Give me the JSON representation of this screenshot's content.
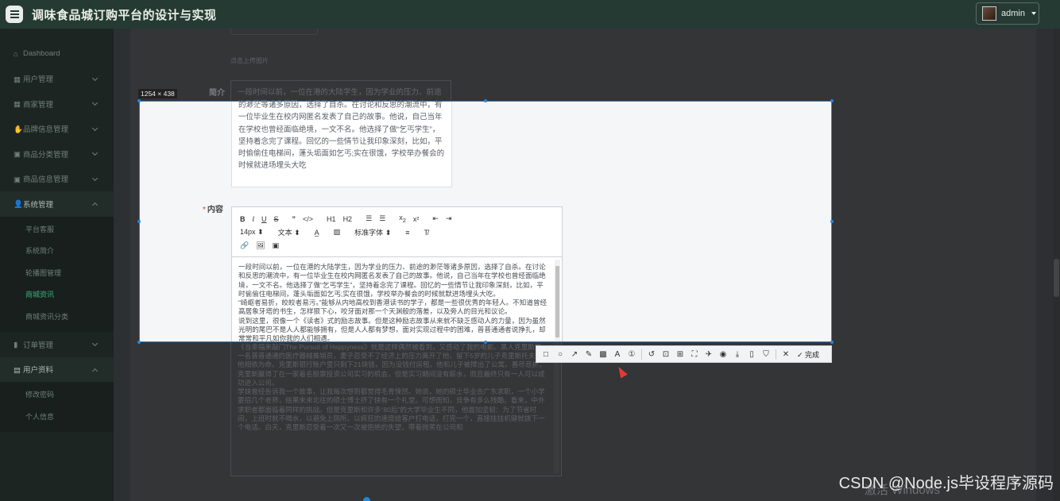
{
  "header": {
    "title": "调味食品城订购平台的设计与实现",
    "user": "admin"
  },
  "sidebar": {
    "items": [
      {
        "label": "Dashboard",
        "icon": "home-icon"
      },
      {
        "label": "用户管理",
        "icon": "grid-icon"
      },
      {
        "label": "商家管理",
        "icon": "grid-icon"
      },
      {
        "label": "品牌信息管理",
        "icon": "hand-icon"
      },
      {
        "label": "商品分类管理",
        "icon": "box-icon"
      },
      {
        "label": "商品信息管理",
        "icon": "box-icon"
      },
      {
        "label": "系统管理",
        "icon": "user-icon"
      }
    ],
    "system_sub": [
      "平台客服",
      "系统简介",
      "轮播图管理",
      "商城资讯",
      "商城资讯分类"
    ],
    "items_after": [
      {
        "label": "订单管理",
        "icon": "bar-chart-icon"
      },
      {
        "label": "用户资料",
        "icon": "calendar-icon"
      }
    ],
    "profile_sub": [
      "修改密码",
      "个人信息"
    ]
  },
  "form": {
    "upload_hint": "点击上传图片",
    "intro_label": "简介",
    "content_label": "内容",
    "required_mark": "*",
    "intro_text": "一段时间以前，一位在港的大陆学生，因为学业的压力、前途的渺茫等诸多原因，选择了自杀。在讨论和反思的潮流中，有一位毕业生在校内网匿名发表了自己的故事。他说，自己当年在学校也曾经面临绝境，一文不名。他选择了做“乞丐学生”，坚持着念完了课程。回忆的一些情节让我印象深刻，比如，平时偷偷住电梯间，蓬头垢面如乞丐;实在很饿，学校举办餐会的时候就进场埋头大吃"
  },
  "editor": {
    "font_size": "14px",
    "block_type": "文本",
    "font_family": "标准字体",
    "buttons": [
      "B",
      "I",
      "U",
      "S",
      "”",
      "</>",
      "H1",
      "H2",
      "list-ol",
      "list-ul",
      "x2",
      "x²",
      "indent-left",
      "indent-right"
    ],
    "paragraphs": [
      "一段时间以前，一位在港的大陆学生，因为学业的压力、前途的渺茫等诸多原因，选择了自杀。在讨论和反思的潮流中，有一位毕业生在校内网匿名发表了自己的故事。他说，自己当年在学校也曾经面临绝境，一文不名。他选择了做“乞丐学生”，坚持着念完了课程。回忆的一些情节让我印象深刻，比如，平时偷偷住电梯间，蓬头垢面如乞丐;实在很饿，学校举办餐会的时候就默进场埋头大吃。",
      "“崎岖者易折，皎皎者易污。”能够从内地高校到香港读书的学子，都是一些很优秀的年轻人。不知道曾经高居象牙塔的书生，怎样狠下心，咬牙面对那一个天渊般的落差，以及旁人的目光和议论。",
      "说到这里，很像一个《读者》式的励志故事。但是这种励志故事从来就不缺乏感动人的力量，因为虽然光明的尾巴不是人人都能够拥有，但是人人都有梦想，面对实现过程中的困难，普普通通者说挣扎，却常常和平凡如你我的人们相遇。",
      "《当幸福来敲门The Pursuit of Happyness》就是这样偶然被看到，又感动了我的电影。黑人克里斯是一名普普通通的医疗器械推销员，妻子忍受不了经济上的压力离开了他，留下5岁的儿子克里斯托夫和他相依为命。克里斯银行账户里只剩下21块钱，因为没钱付房租，他和儿子被撵出了公寓。喜尽悲折，克里斯赢得了在一家着名股票投资公司实习的机会，但是实习期间没有薪水，而且最终只有一人可以成功进入公司。",
      "学妹曾经告诉我一个故事，让我每次想到都觉得毛骨悚然。她说，她的硕士毕业去广东求职，一个小学要招几个老师，结果来来北往的硕士博士挤了快有一个礼堂。可想而知，竞争有多么残酷。看来，中外求职者都面临着同样的挑战。但是克里斯和许多“80后”的大学毕业生不同，他首加坚韧：为了节省时间，上班时就不喝水，以避免上厕所。以疯狂的速度给客户打电话，打完一个，直接挂挂机键就拨下一个电话。白天，克里斯忍受着一次又一次被拒绝的失望，带着微笑在公司和"
    ]
  },
  "overlay": {
    "size_label": "1254 × 438",
    "snip_done": "完成"
  },
  "watermark": "CSDN @Node.js毕设程序源码",
  "os_activate": "激活 Windows"
}
